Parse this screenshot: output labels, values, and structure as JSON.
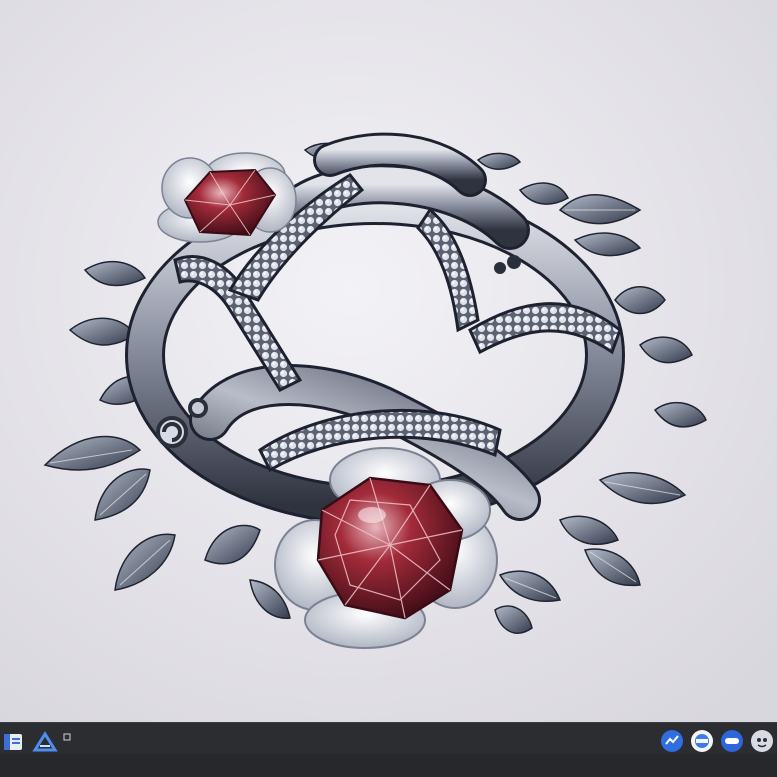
{
  "artwork": {
    "subject": "silver-knot-brooch",
    "palette": {
      "background": "#e6e4ea",
      "metal_light": "#c9ccd6",
      "metal_mid": "#7d8294",
      "metal_dark": "#2f3340",
      "gem_red": "#8a1f2c",
      "gem_highlight": "#e7b7bd",
      "flower_white": "#f0eff4",
      "leaf_dark": "#3e4456"
    }
  },
  "taskbar": {
    "background": "#2c2d31",
    "left_icons": [
      {
        "icon": "file-explorer-icon"
      },
      {
        "icon": "app-a-icon"
      },
      {
        "icon": "small-square-icon"
      }
    ],
    "right_icons": [
      {
        "icon": "chart-app-icon",
        "color": "#2f6fe0"
      },
      {
        "icon": "circle-app-icon",
        "color": "#3d7be6"
      },
      {
        "icon": "pill-app-icon",
        "color": "#2c66d8"
      },
      {
        "icon": "face-app-icon",
        "color": "#d9dbe2"
      }
    ]
  }
}
